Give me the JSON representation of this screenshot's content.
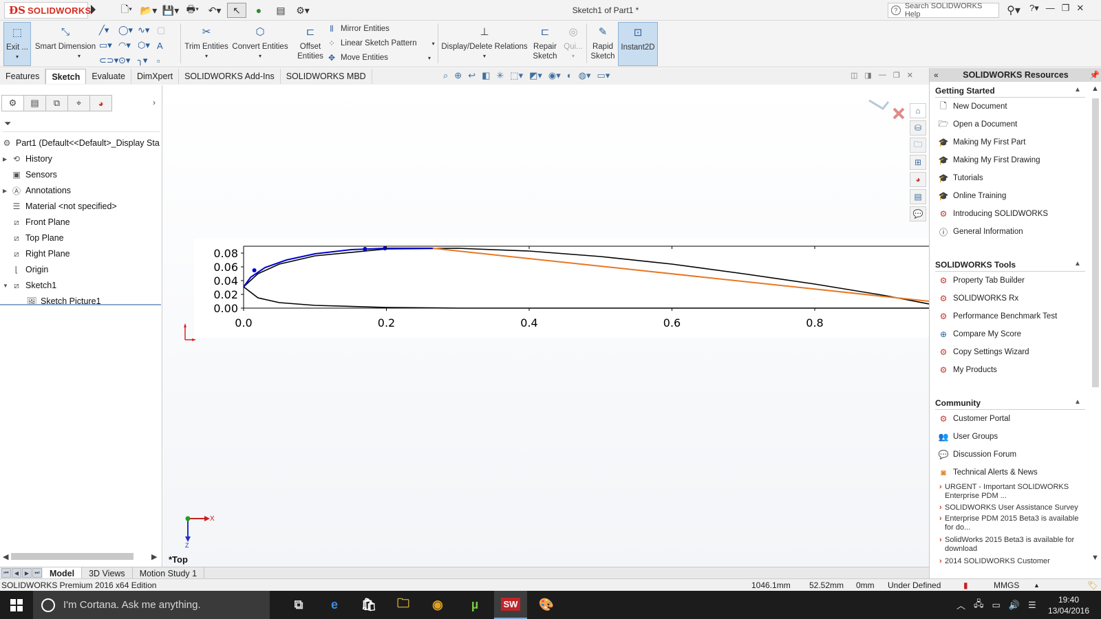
{
  "app": {
    "logo_text": "SOLIDWORKS",
    "document_title": "Sketch1 of Part1 *",
    "search_placeholder": "Search SOLIDWORKS Help"
  },
  "ribbon": {
    "exit": "Exit ...",
    "smart_dimension": "Smart Dimension",
    "trim_entities": "Trim Entities",
    "convert_entities": "Convert Entities",
    "offset_line1": "Offset",
    "offset_line2": "Entities",
    "mirror_entities": "Mirror Entities",
    "linear_pattern": "Linear Sketch Pattern",
    "move_entities": "Move Entities",
    "display_delete": "Display/Delete Relations",
    "repair_line1": "Repair",
    "repair_line2": "Sketch",
    "quick_snaps": "Qui...",
    "rapid_line1": "Rapid",
    "rapid_line2": "Sketch",
    "instant2d": "Instant2D"
  },
  "tabs": [
    "Features",
    "Sketch",
    "Evaluate",
    "DimXpert",
    "SOLIDWORKS Add-Ins",
    "SOLIDWORKS MBD"
  ],
  "feature_tree": {
    "root": "Part1  (Default<<Default>_Display Sta",
    "items": [
      "History",
      "Sensors",
      "Annotations",
      "Material <not specified>",
      "Front Plane",
      "Top Plane",
      "Right Plane",
      "Origin",
      "Sketch1",
      "Sketch Picture1"
    ]
  },
  "chart_data": {
    "type": "line",
    "xlim": [
      0.0,
      0.96
    ],
    "ylim": [
      0.0,
      0.09
    ],
    "x_ticks": [
      "0.0",
      "0.2",
      "0.4",
      "0.6",
      "0.8"
    ],
    "y_ticks": [
      "0.00",
      "0.02",
      "0.04",
      "0.06",
      "0.08"
    ],
    "series": [
      {
        "color": "#000000",
        "x": [
          0.0,
          0.02,
          0.05,
          0.1,
          0.2,
          0.3,
          0.4,
          0.5,
          0.6,
          0.7,
          0.8,
          0.9,
          0.96
        ],
        "y": [
          0.031,
          0.05,
          0.064,
          0.076,
          0.086,
          0.087,
          0.083,
          0.075,
          0.064,
          0.05,
          0.035,
          0.018,
          0.006
        ]
      },
      {
        "color": "#000000",
        "x": [
          0.0,
          0.02,
          0.05,
          0.1,
          0.2,
          0.3,
          0.4,
          0.6,
          0.8,
          0.96
        ],
        "y": [
          0.031,
          0.015,
          0.008,
          0.004,
          0.001,
          0.0,
          0.0,
          0.0,
          0.0,
          0.0
        ]
      },
      {
        "color": "#0000cc",
        "x": [
          0.0,
          0.01,
          0.03,
          0.06,
          0.1,
          0.15,
          0.2,
          0.265
        ],
        "y": [
          0.031,
          0.045,
          0.059,
          0.07,
          0.079,
          0.085,
          0.087,
          0.087
        ]
      },
      {
        "color": "#e87722",
        "x": [
          0.265,
          0.96
        ],
        "y": [
          0.087,
          0.01
        ]
      }
    ]
  },
  "view_label": "*Top",
  "resources": {
    "title": "SOLIDWORKS Resources",
    "getting_started": "Getting Started",
    "gs_items": [
      "New Document",
      "Open a Document",
      "Making My First Part",
      "Making My First Drawing",
      "Tutorials",
      "Online Training",
      "Introducing SOLIDWORKS",
      "General Information"
    ],
    "tools": "SOLIDWORKS Tools",
    "tool_items": [
      "Property Tab Builder",
      "SOLIDWORKS Rx",
      "Performance Benchmark Test",
      "Compare My Score",
      "Copy Settings Wizard",
      "My Products"
    ],
    "community": "Community",
    "community_items": [
      "Customer Portal",
      "User Groups",
      "Discussion Forum",
      "Technical Alerts & News"
    ],
    "news": [
      "URGENT - Important SOLIDWORKS Enterprise PDM ...",
      "SOLIDWORKS User Assistance Survey",
      "Enterprise PDM 2015 Beta3 is available for do...",
      "SolidWorks 2015 Beta3 is available for download",
      "2014 SOLIDWORKS Customer"
    ]
  },
  "bottom_tabs": [
    "Model",
    "3D Views",
    "Motion Study 1"
  ],
  "status": {
    "edition": "SOLIDWORKS Premium 2016 x64 Edition",
    "x": "1046.1mm",
    "y": "52.52mm",
    "z": "0mm",
    "state": "Under Defined",
    "units": "MMGS"
  },
  "taskbar": {
    "cortana": "I'm Cortana. Ask me anything.",
    "time": "19:40",
    "date": "13/04/2016"
  }
}
